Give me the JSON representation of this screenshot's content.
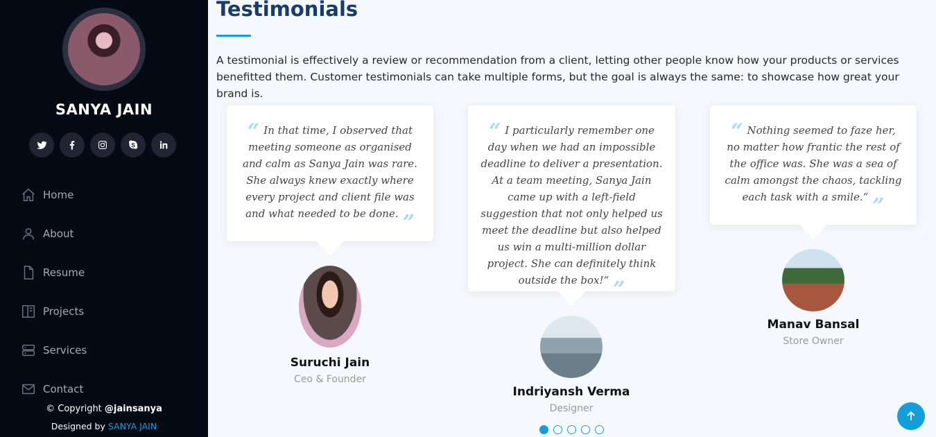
{
  "profile": {
    "name": "SANYA JAIN"
  },
  "socials": [
    {
      "icon": "twitter-icon"
    },
    {
      "icon": "facebook-icon"
    },
    {
      "icon": "instagram-icon"
    },
    {
      "icon": "skype-icon"
    },
    {
      "icon": "linkedin-icon"
    }
  ],
  "nav": [
    {
      "label": "Home",
      "icon": "home-icon"
    },
    {
      "label": "About",
      "icon": "person-icon"
    },
    {
      "label": "Resume",
      "icon": "file-icon"
    },
    {
      "label": "Projects",
      "icon": "book-icon"
    },
    {
      "label": "Services",
      "icon": "server-icon"
    },
    {
      "label": "Contact",
      "icon": "envelope-icon"
    }
  ],
  "footer": {
    "copyright_prefix": "© Copyright",
    "copyright_handle": "@jainsanya",
    "designed_prefix": "Designed by",
    "designed_name": "SANYA JAIN"
  },
  "section": {
    "title": "Testimonials",
    "intro": "A testimonial is effectively a review or recommendation from a client, letting other people know how your products or services benefitted them. Customer testimonials can take multiple forms, but the goal is always the same: to showcase how great your brand is."
  },
  "testimonials": [
    {
      "quote": "In that time, I observed that meeting someone as organised and calm as Sanya Jain was rare. She always knew exactly where every project and client file was and what needed to be done.",
      "name": "Suruchi Jain",
      "role": "Ceo & Founder"
    },
    {
      "quote": "I particularly remember one day when we had an impossible deadline to deliver a presentation. At a team meeting, Sanya Jain came up with a left-field suggestion that not only helped us meet the deadline but also helped us win a multi-million dollar project. She can definitely think outside the box!“",
      "name": "Indriyansh Verma",
      "role": "Designer"
    },
    {
      "quote": "Nothing seemed to faze her, no matter how frantic the rest of the office was. She was a sea of calm amongst the chaos, tackling each task with a smile.“",
      "name": "Manav Bansal",
      "role": "Store Owner"
    }
  ],
  "quote_marks": {
    "open": "“",
    "close": "”"
  },
  "pagination": {
    "total": 5,
    "active": 1
  },
  "colors": {
    "accent": "#149ddd",
    "sidebar_bg": "#040b14",
    "title": "#173b6c"
  }
}
